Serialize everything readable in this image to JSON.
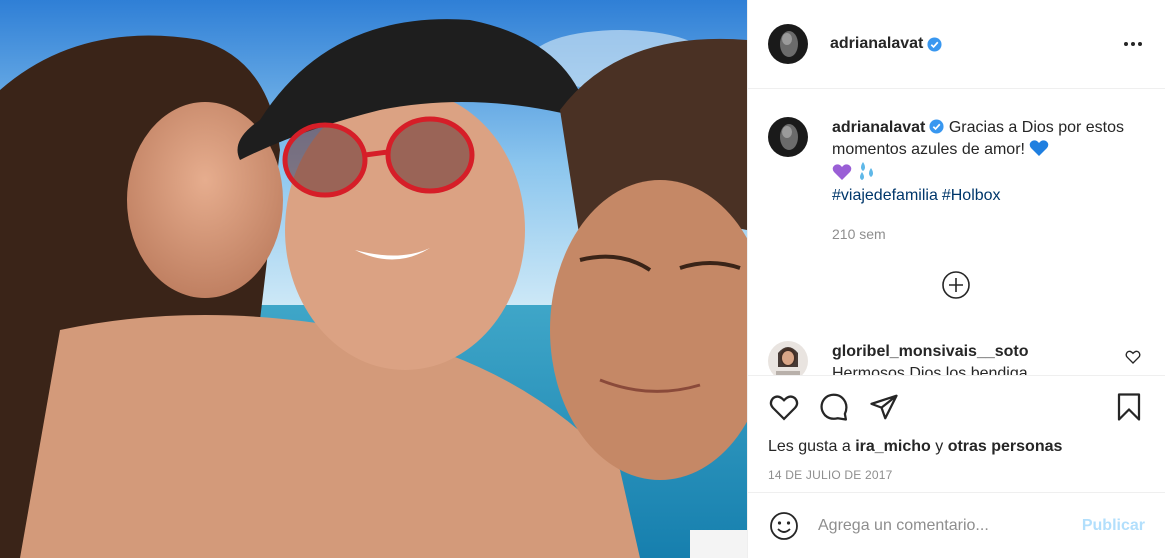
{
  "post": {
    "author": "adrianalavat",
    "verified": true,
    "caption": "Gracias a Dios por estos momentos azules de amor!",
    "hashtags": [
      "#viajedefamilia",
      "#Holbox"
    ],
    "caption_time": "210 sem",
    "photo_alt": "selfie",
    "icons": {
      "more": "more-dots-icon",
      "load_more": "plus-circle-icon",
      "like": "heart-icon",
      "comment": "comment-icon",
      "share": "send-icon",
      "save": "bookmark-icon",
      "emoji": "smiley-icon",
      "verified": "verified-badge-icon"
    }
  },
  "comment": {
    "username": "gloribel_monsivais__soto",
    "text_partial": "Hermosos Dios los bendiga"
  },
  "likes": {
    "prefix": "Les gusta a",
    "user": "ira_micho",
    "connector": "y",
    "others": "otras personas"
  },
  "date": "14 DE JULIO DE 2017",
  "add_comment": {
    "placeholder": "Agrega un comentario...",
    "publish_label": "Publicar"
  },
  "colors": {
    "verified": "#3897f0",
    "link": "#00376b",
    "secondary": "#8e8e8e",
    "publish_disabled": "#b2dffc"
  }
}
